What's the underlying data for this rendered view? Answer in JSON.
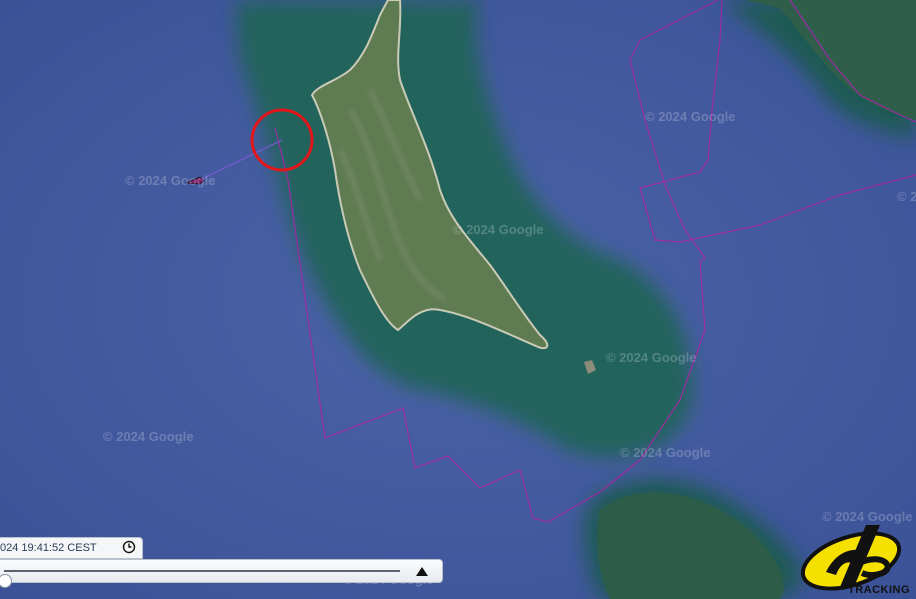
{
  "map": {
    "watermarks": [
      "© 2024 Google",
      "© 2024 Google",
      "© 2024 Google",
      "© 2024 Google",
      "© 2024 Google",
      "© 2024 Google",
      "© 2024 Google",
      "© 2024 Google",
      "© 2024 Google"
    ],
    "colors": {
      "sea": "#3f5599",
      "shallow": "#2e6a5f",
      "land": "#5d7a4f",
      "track": "#8a2a9a",
      "highlight_circle": "#e3161b",
      "boat": "#7a1f6a"
    }
  },
  "timeline": {
    "timestamp": "024 19:41:52 CEST",
    "clock_icon": "clock-icon",
    "play_icon": "play-triangle-icon",
    "position_fraction": 0.0
  },
  "branding": {
    "logo_icon": "yb-tracking-logo",
    "label": "TRACKING"
  }
}
